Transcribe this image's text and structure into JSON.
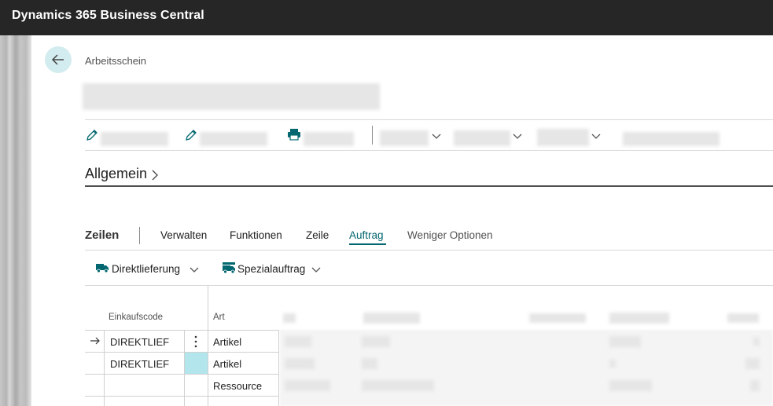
{
  "app": {
    "title": "Dynamics 365 Business Central"
  },
  "page": {
    "breadcrumb": "Arbeitsschein"
  },
  "icons": {
    "back": "arrow-left-icon",
    "edit": "pencil-icon",
    "print": "printer-icon",
    "chevron": "chevron-down-icon",
    "truck": "truck-icon",
    "special_order": "truck-list-icon",
    "row_arrow": "arrow-right-icon",
    "row_menu": "vertical-ellipsis-icon"
  },
  "colors": {
    "topbar": "#262626",
    "accent": "#00666f",
    "selected_cell": "#b3e5ec"
  },
  "general": {
    "title": "Allgemein"
  },
  "lines": {
    "title": "Zeilen",
    "tabs": [
      {
        "label": "Verwalten"
      },
      {
        "label": "Funktionen"
      },
      {
        "label": "Zeile"
      },
      {
        "label": "Auftrag"
      },
      {
        "label": "Weniger Optionen"
      }
    ],
    "active_tab": "Auftrag",
    "actions": [
      {
        "label": "Direktlieferung"
      },
      {
        "label": "Spezialauftrag"
      }
    ],
    "columns": {
      "purchasing_code": "Einkaufscode",
      "type": "Art"
    },
    "rows": [
      {
        "purchasing_code": "DIREKTLIEF",
        "type": "Artikel"
      },
      {
        "purchasing_code": "DIREKTLIEF",
        "type": "Artikel"
      },
      {
        "purchasing_code": "",
        "type": "Ressource"
      }
    ]
  }
}
